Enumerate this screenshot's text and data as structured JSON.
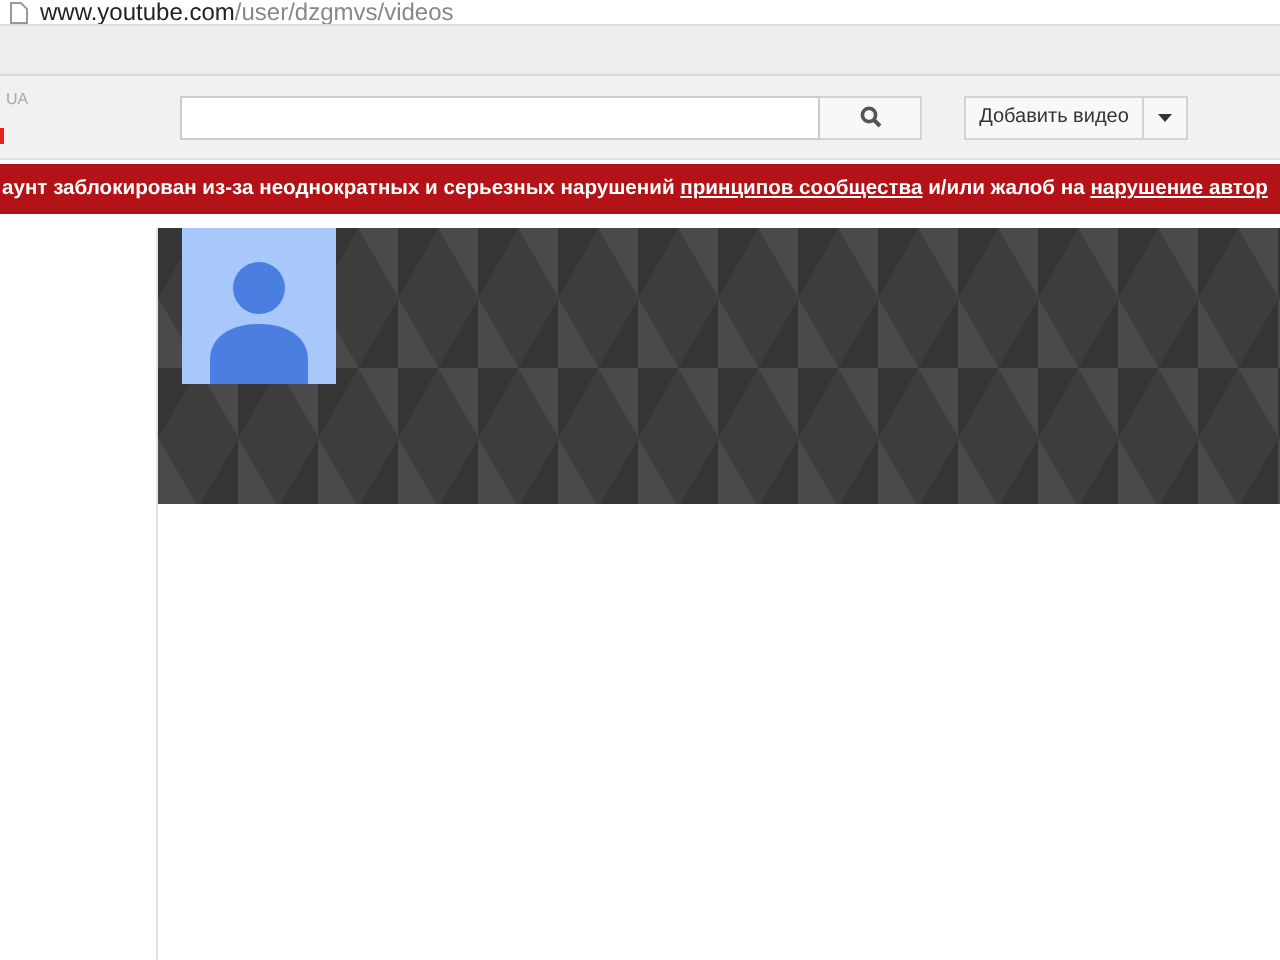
{
  "address_bar": {
    "domain": "www.youtube.com",
    "path": "/user/dzgmvs/videos"
  },
  "header": {
    "logo_fragment": "UA",
    "upload_button": "Добавить видео"
  },
  "banner": {
    "segments": [
      {
        "kind": "text",
        "text": "аунт заблокирован из-за неоднократных и серьезных нарушений "
      },
      {
        "kind": "link",
        "text": "принципов сообщества"
      },
      {
        "kind": "text",
        "text": " и/или жалоб на "
      },
      {
        "kind": "link",
        "text": "нарушение автор"
      }
    ]
  }
}
